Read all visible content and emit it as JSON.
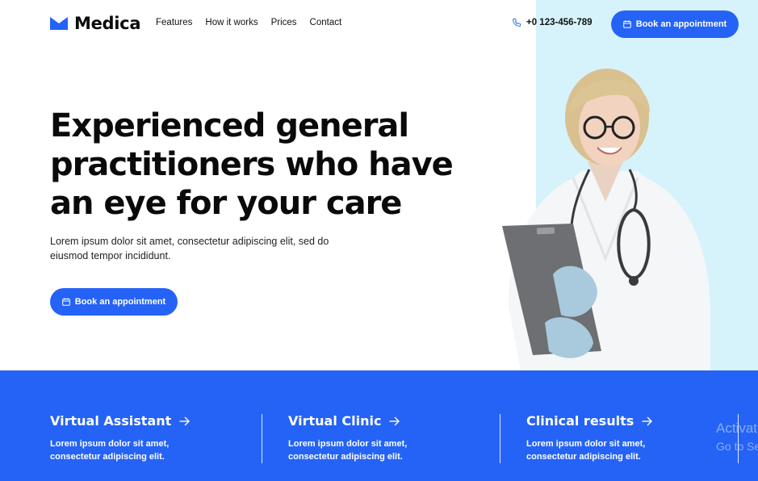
{
  "brand": {
    "name": "Medica",
    "accent": "#2563f6",
    "panel": "#d6f2fb"
  },
  "nav": {
    "items": [
      "Features",
      "How it works",
      "Prices",
      "Contact"
    ]
  },
  "contact": {
    "phone": "+0 123-456-789",
    "icon": "phone-icon"
  },
  "header": {
    "cta_label": "Book an appointment"
  },
  "hero": {
    "title_lines": [
      "Experienced general",
      "practitioners who have",
      "an eye for your care"
    ],
    "subtitle_lines": [
      "Lorem ipsum dolor sit amet, consectetur adipiscing elit, sed do",
      "eiusmod tempor incididunt."
    ],
    "cta_label": "Book an appointment"
  },
  "features": [
    {
      "title": "Virtual Assistant",
      "text_lines": [
        "Lorem ipsum dolor sit amet,",
        "consectetur adipiscing elit."
      ]
    },
    {
      "title": "Virtual Clinic",
      "text_lines": [
        "Lorem ipsum dolor sit amet,",
        "consectetur adipiscing elit."
      ]
    },
    {
      "title": "Clinical results",
      "text_lines": [
        "Lorem ipsum dolor sit amet,",
        "consectetur adipiscing elit."
      ]
    }
  ],
  "watermark": {
    "line1": "Activate",
    "line2": "Go to Settings"
  }
}
